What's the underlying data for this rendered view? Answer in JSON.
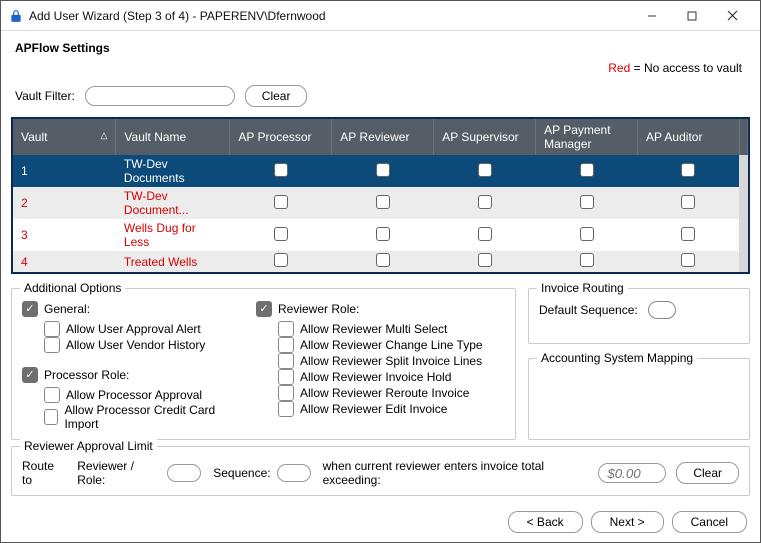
{
  "window": {
    "title": "Add User Wizard (Step 3 of 4) - PAPERENV\\Dfernwood"
  },
  "section_title": "APFlow Settings",
  "red_note": {
    "red_word": "Red",
    "rest": " = No access to vault"
  },
  "filter": {
    "label": "Vault Filter:",
    "value": "",
    "clear": "Clear"
  },
  "grid": {
    "headers": {
      "vault": "Vault",
      "vault_name": "Vault Name",
      "ap_processor": "AP Processor",
      "ap_reviewer": "AP Reviewer",
      "ap_supervisor": "AP Supervisor",
      "ap_payment_manager": "AP Payment Manager",
      "ap_auditor": "AP Auditor"
    },
    "rows": [
      {
        "id": "1",
        "name": "TW-Dev Documents",
        "selected": true,
        "red": false
      },
      {
        "id": "2",
        "name": "TW-Dev Document...",
        "selected": false,
        "red": true
      },
      {
        "id": "3",
        "name": "Wells Dug for Less",
        "selected": false,
        "red": true
      },
      {
        "id": "4",
        "name": "Treated Wells",
        "selected": false,
        "red": true
      }
    ]
  },
  "additional": {
    "legend": "Additional Options",
    "general": {
      "header": "General:",
      "checked": true,
      "items": [
        {
          "label": "Allow User Approval Alert",
          "checked": false
        },
        {
          "label": "Allow User Vendor History",
          "checked": false
        }
      ]
    },
    "processor": {
      "header": "Processor Role:",
      "checked": true,
      "items": [
        {
          "label": "Allow Processor Approval",
          "checked": false
        },
        {
          "label": "Allow Processor Credit Card Import",
          "checked": false
        }
      ]
    },
    "reviewer": {
      "header": "Reviewer Role:",
      "checked": true,
      "items": [
        {
          "label": "Allow Reviewer Multi Select",
          "checked": false
        },
        {
          "label": "Allow Reviewer Change Line Type",
          "checked": false
        },
        {
          "label": "Allow Reviewer Split Invoice Lines",
          "checked": false
        },
        {
          "label": "Allow Reviewer Invoice Hold",
          "checked": false
        },
        {
          "label": "Allow Reviewer Reroute Invoice",
          "checked": false
        },
        {
          "label": "Allow Reviewer Edit Invoice",
          "checked": false
        }
      ]
    }
  },
  "routing": {
    "legend": "Invoice Routing",
    "default_seq_label": "Default Sequence:"
  },
  "asm": {
    "legend": "Accounting System Mapping"
  },
  "approval": {
    "legend": "Reviewer Approval Limit",
    "route_to": "Route to",
    "reviewer_role": "Reviewer / Role:",
    "sequence": "Sequence:",
    "when_text": "when current reviewer enters invoice total exceeding:",
    "money_placeholder": "$0.00",
    "clear": "Clear"
  },
  "footer": {
    "back": "< Back",
    "next": "Next >",
    "cancel": "Cancel"
  }
}
